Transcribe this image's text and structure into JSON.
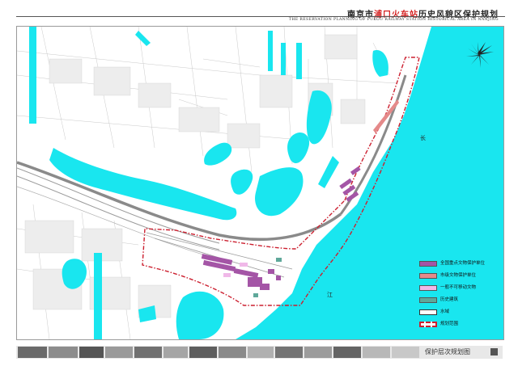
{
  "title": {
    "prefix": "南京市",
    "highlight": "浦口火车站",
    "suffix": "历史风貌区保护规划",
    "english": "THE RESERVATION PLANNING OF PUKOU RAILWAY STATION HISTORICAL AREA IN NANJING"
  },
  "river_labels": [
    "长",
    "江"
  ],
  "legend": [
    {
      "label": "全国重点文物保护单位",
      "color": "#a455a6"
    },
    {
      "label": "市级文物保护单位",
      "color": "#e58a8a"
    },
    {
      "label": "一般不可移动文物",
      "color": "#f0b8e8"
    },
    {
      "label": "历史建筑",
      "color": "#5fa89a"
    },
    {
      "label": "水域",
      "color": "#ffffff"
    },
    {
      "label": "规划范围",
      "color": "#cc1f2f"
    }
  ],
  "colors": {
    "water": "#19e6ef",
    "boundary": "#cc1f2f",
    "national_relic": "#a455a6"
  },
  "strip": {
    "title": "保护层次规划图"
  },
  "icons": [
    "compass-icon"
  ]
}
